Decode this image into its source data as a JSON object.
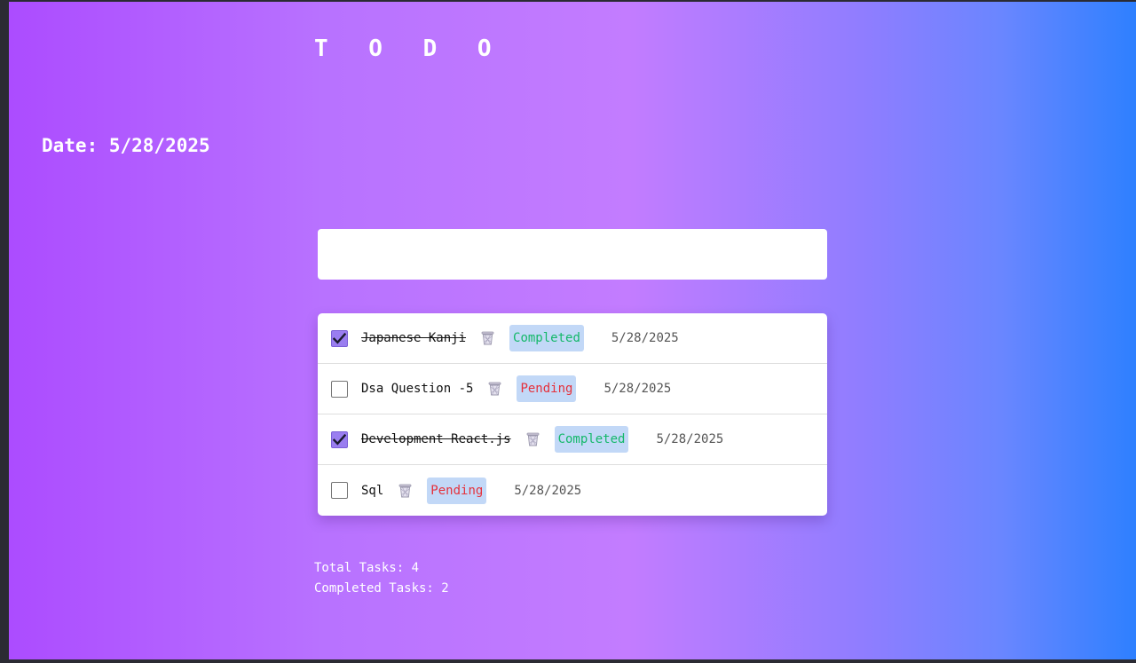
{
  "app_title": "T O D O",
  "date_label": "Date: 5/28/2025",
  "new_task": {
    "value": "",
    "placeholder": ""
  },
  "tasks": [
    {
      "title": "Japanese Kanji",
      "completed": true,
      "status": "Completed",
      "date": "5/28/2025"
    },
    {
      "title": "Dsa Question -5",
      "completed": false,
      "status": "Pending",
      "date": "5/28/2025"
    },
    {
      "title": "Development React.js",
      "completed": true,
      "status": "Completed",
      "date": "5/28/2025"
    },
    {
      "title": "Sql",
      "completed": false,
      "status": "Pending",
      "date": "5/28/2025"
    }
  ],
  "stats": {
    "total": "Total Tasks: 4",
    "completed": "Completed Tasks: 2"
  },
  "icons": {
    "delete": "trash-icon",
    "check": "check-icon"
  },
  "colors": {
    "completed_text": "#14b86a",
    "pending_text": "#e5313b",
    "badge_bg": "#c2d8f7",
    "checkbox_checked": "#9a7ef0"
  }
}
